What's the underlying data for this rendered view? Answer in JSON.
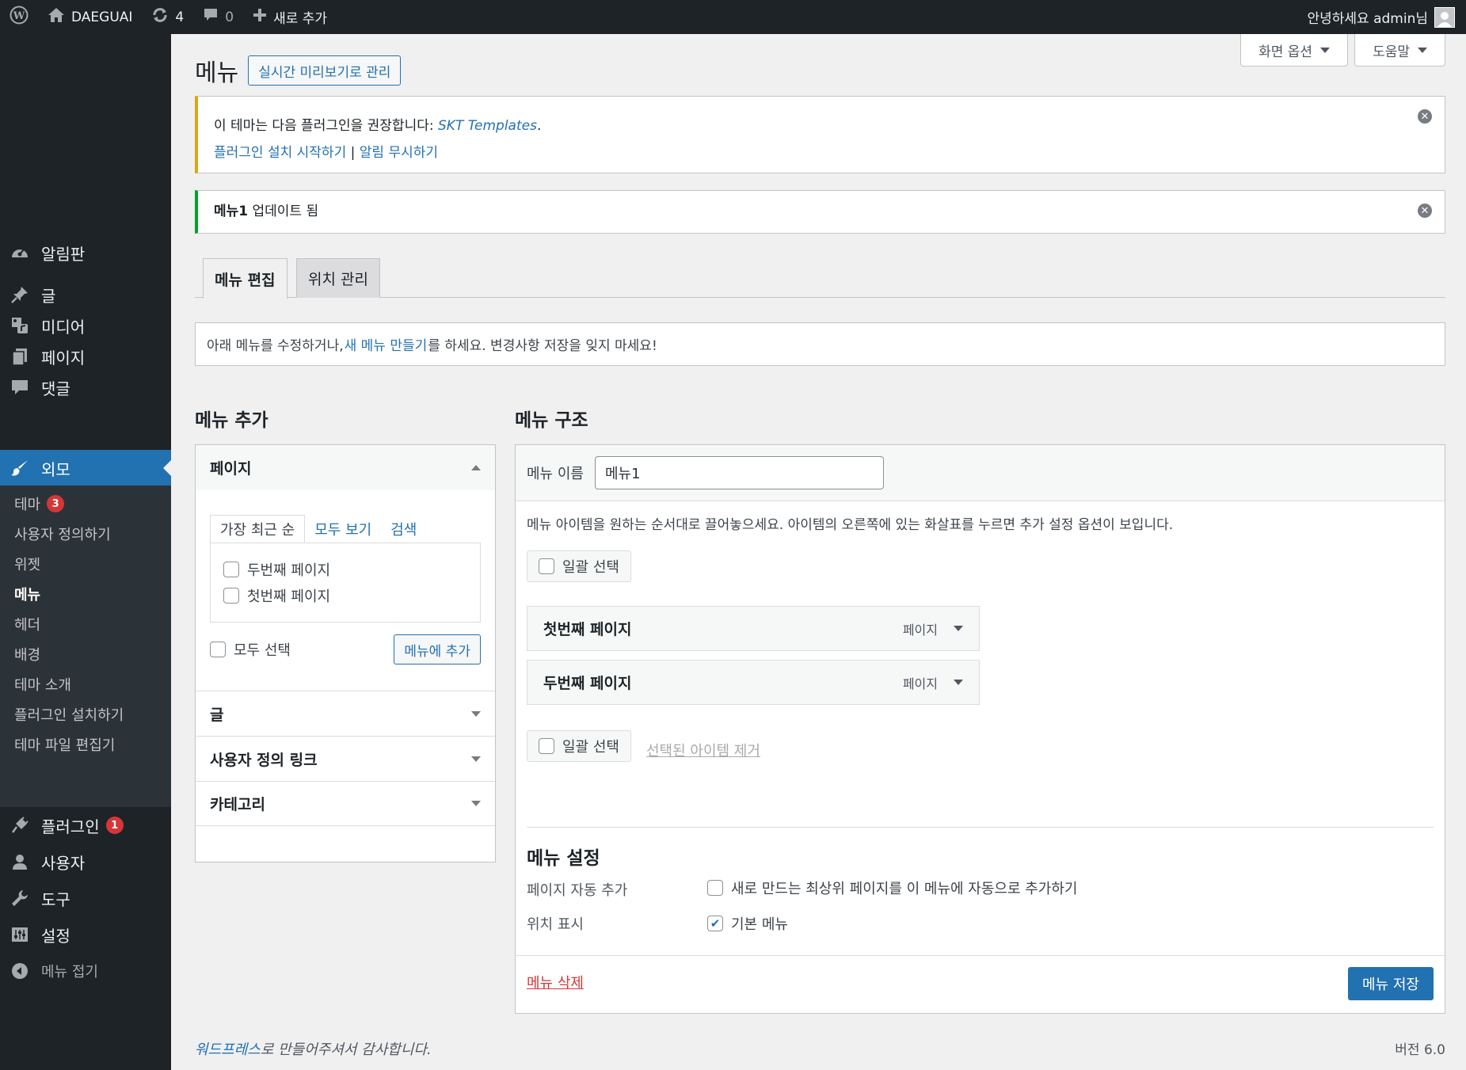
{
  "adminbar": {
    "site_name": "DAEGUAI",
    "updates_count": "4",
    "comments_count": "0",
    "new_label": "새로 추가",
    "greeting": "안녕하세요 admin님"
  },
  "sidebar": {
    "dashboard": "알림판",
    "posts": "글",
    "media": "미디어",
    "pages": "페이지",
    "comments": "댓글",
    "appearance": "외모",
    "submenu": {
      "themes": "테마",
      "themes_badge": "3",
      "customize": "사용자 정의하기",
      "widgets": "위젯",
      "menus": "메뉴",
      "header": "헤더",
      "background": "배경",
      "theme_intro": "테마 소개",
      "install_plugins": "플러그인 설치하기",
      "theme_editor": "테마 파일 편집기"
    },
    "plugins": "플러그인",
    "plugins_badge": "1",
    "users": "사용자",
    "tools": "도구",
    "settings": "설정",
    "collapse": "메뉴 접기"
  },
  "screen_meta": {
    "screen_options": "화면 옵션",
    "help": "도움말"
  },
  "page": {
    "title": "메뉴",
    "live_preview": "실시간 미리보기로 관리"
  },
  "notice_warning": {
    "text": "이 테마는 다음 플러그인을 권장합니다: ",
    "plugin": "SKT Templates",
    "period": ".",
    "install_link": "플러그인 설치 시작하기",
    "separator": " | ",
    "dismiss_link": "알림 무시하기"
  },
  "notice_success": {
    "menu_name": "메뉴1",
    "text": " 업데이트 됨"
  },
  "tabs": {
    "edit": "메뉴 편집",
    "locations": "위치 관리"
  },
  "manage": {
    "prefix": "아래 메뉴를 수정하거나, ",
    "link": "새 메뉴 만들기",
    "suffix": "를 하세요. 변경사항 저장을 잊지 마세요!"
  },
  "add_menu": {
    "title": "메뉴 추가",
    "pages_header": "페이지",
    "inner_tabs": [
      "가장 최근 순",
      "모두 보기",
      "검색"
    ],
    "page_items": [
      "두번째 페이지",
      "첫번째 페이지"
    ],
    "select_all": "모두 선택",
    "add_button": "메뉴에 추가",
    "posts_header": "글",
    "custom_links_header": "사용자 정의 링크",
    "categories_header": "카테고리"
  },
  "structure": {
    "title": "메뉴 구조",
    "name_label": "메뉴 이름",
    "name_value": "메뉴1",
    "instructions": "메뉴 아이템을 원하는 순서대로 끌어놓으세요. 아이템의 오른쪽에 있는 화살표를 누르면 추가 설정 옵션이 보입니다.",
    "bulk_select": "일괄 선택",
    "items": [
      {
        "title": "첫번째 페이지",
        "type": "페이지"
      },
      {
        "title": "두번째 페이지",
        "type": "페이지"
      }
    ],
    "remove_selected": "선택된 아이템 제거",
    "settings_title": "메뉴 설정",
    "auto_add_label": "페이지 자동 추가",
    "auto_add_option": "새로 만드는 최상위 페이지를 이 메뉴에 자동으로 추가하기",
    "location_label": "위치 표시",
    "location_option": "기본 메뉴",
    "delete_link": "메뉴 삭제",
    "save_button": "메뉴 저장"
  },
  "footer": {
    "credit_link": "워드프레스",
    "credit_text": "로 만들어주셔서 감사합니다.",
    "version": "버전 6.0"
  },
  "colors": {
    "admin_bar": "#1d2327",
    "accent": "#2271b1",
    "warning": "#dba617",
    "success": "#00a32a",
    "danger": "#d63638"
  }
}
